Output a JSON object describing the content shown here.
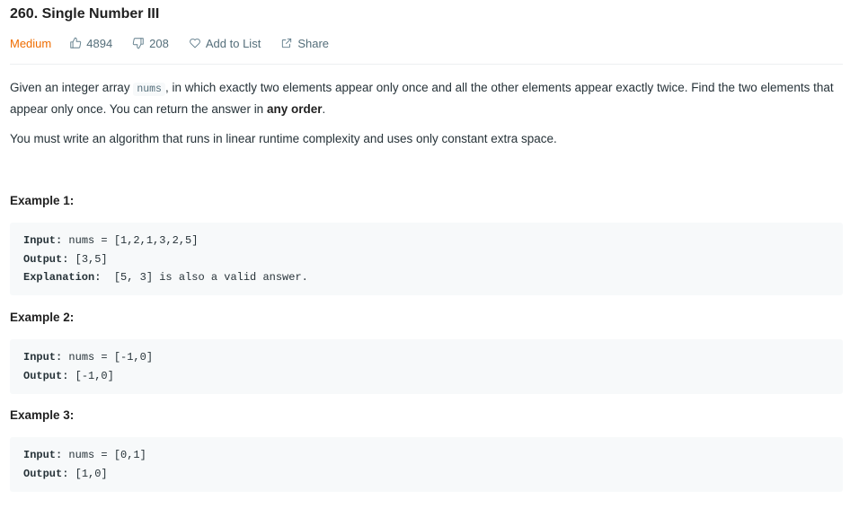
{
  "problem": {
    "title": "260. Single Number III",
    "difficulty": "Medium",
    "likes": "4894",
    "dislikes": "208",
    "add_to_list": "Add to List",
    "share": "Share"
  },
  "description": {
    "p1_pre": "Given an integer array ",
    "p1_code": "nums",
    "p1_mid": ", in which exactly two elements appear only once and all the other elements appear exactly twice. Find the two elements that appear only once. You can return the answer in ",
    "p1_bold": "any order",
    "p1_post": ".",
    "p2": "You must write an algorithm that runs in linear runtime complexity and uses only constant extra space."
  },
  "examples": [
    {
      "heading": "Example 1:",
      "input_label": "Input:",
      "input_value": " nums = [1,2,1,3,2,5]",
      "output_label": "Output:",
      "output_value": " [3,5]",
      "explanation_label": "Explanation:",
      "explanation_value": "  [5, 3] is also a valid answer."
    },
    {
      "heading": "Example 2:",
      "input_label": "Input:",
      "input_value": " nums = [-1,0]",
      "output_label": "Output:",
      "output_value": " [-1,0]"
    },
    {
      "heading": "Example 3:",
      "input_label": "Input:",
      "input_value": " nums = [0,1]",
      "output_label": "Output:",
      "output_value": " [1,0]"
    }
  ],
  "colors": {
    "difficulty_medium": "#ef6c00",
    "code_background": "#f7f9fa",
    "meta_text": "#546e7a"
  },
  "icons": {
    "likes": "thumbs-up-icon",
    "dislikes": "thumbs-down-icon",
    "add_to_list": "heart-icon",
    "share": "share-icon"
  }
}
